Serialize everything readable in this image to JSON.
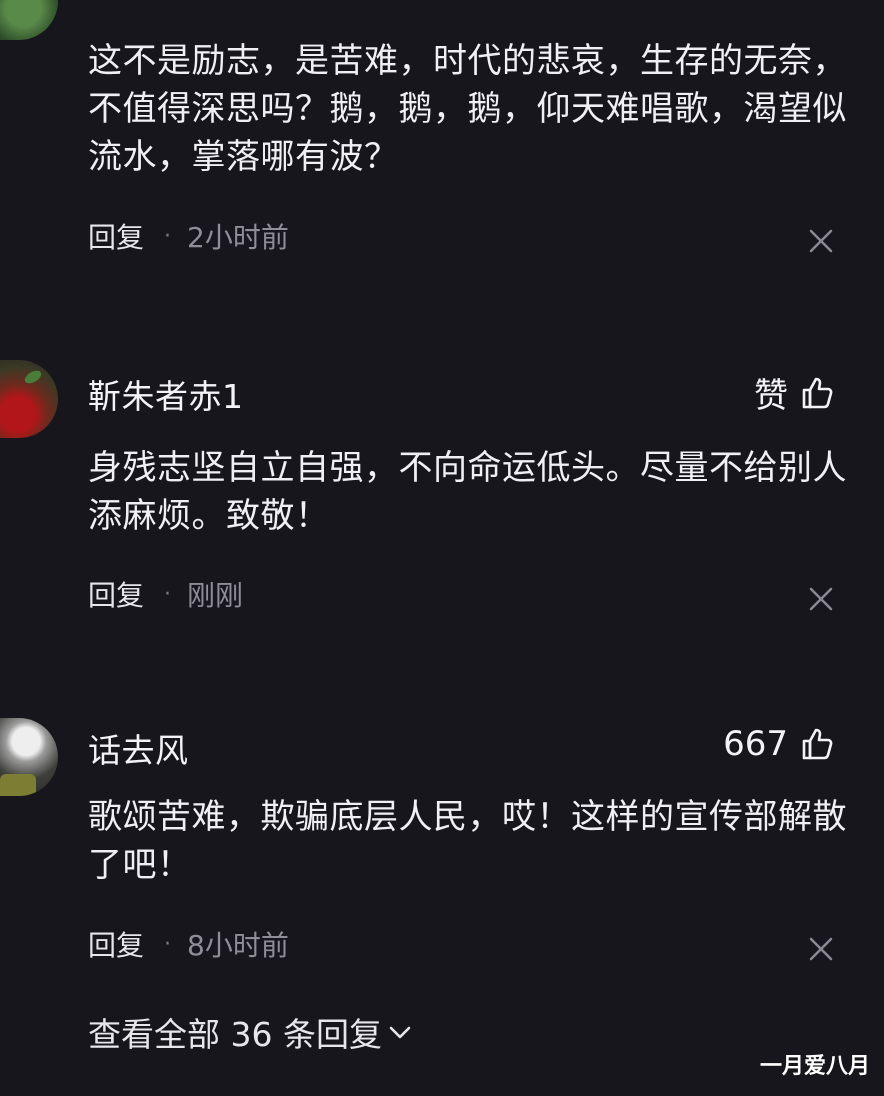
{
  "comments": [
    {
      "username": "",
      "likes": "",
      "content": "这不是励志，是苦难，时代的悲哀，生存的无奈，不值得深思吗？鹅，鹅，鹅，仰天难唱歌，渴望似流水，掌落哪有波？",
      "reply_label": "回复",
      "separator": "·",
      "time": "2小时前",
      "avatar_icon": "avatar-plant"
    },
    {
      "username": "靳朱者赤1",
      "likes": "赞",
      "content": "身残志坚自立自强，不向命运低头。尽量不给别人添麻烦。致敬！",
      "reply_label": "回复",
      "separator": "·",
      "time": "刚刚",
      "avatar_icon": "avatar-flowers"
    },
    {
      "username": "话去风",
      "likes": "667",
      "content": "歌颂苦难，欺骗底层人民，哎！这样的宣传部解散了吧！",
      "reply_label": "回复",
      "separator": "·",
      "time": "8小时前",
      "avatar_icon": "avatar-helmet"
    }
  ],
  "footer": {
    "view_all": "查看全部 36 条回复",
    "chevron_icon": "chevron-down-icon"
  },
  "watermark": "一月爱八月",
  "colors": {
    "background": "#17161d",
    "text": "#f0eff4",
    "muted": "#8e8d98"
  }
}
